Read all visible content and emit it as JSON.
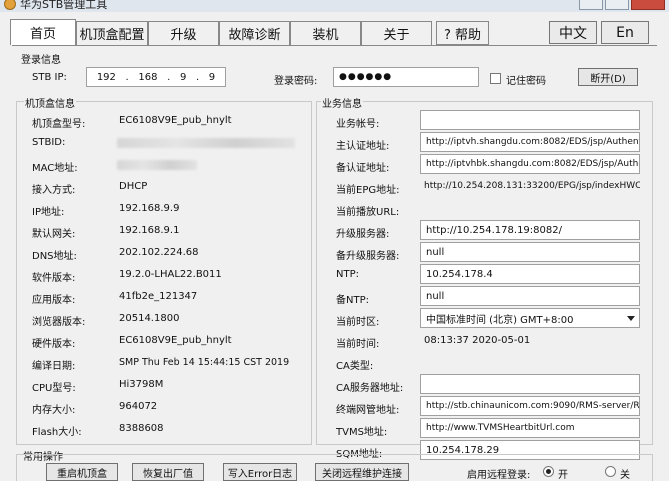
{
  "window": {
    "title": "华为STB管理工具"
  },
  "tabs": [
    {
      "label": "首页"
    },
    {
      "label": "机顶盒配置"
    },
    {
      "label": "升级"
    },
    {
      "label": "故障诊断"
    },
    {
      "label": "装机"
    },
    {
      "label": "关于"
    },
    {
      "label": "? 帮助"
    }
  ],
  "lang": {
    "cn": "中文",
    "en": "En"
  },
  "login": {
    "section": "登录信息",
    "stb_ip_label": "STB IP:",
    "ip": [
      "192",
      "168",
      "9",
      "9"
    ],
    "password_label": "登录密码:",
    "password": "●●●●●●",
    "remember": "记住密码",
    "disconnect": "断开(D)"
  },
  "box_info": {
    "section": "机顶盒信息",
    "rows": [
      {
        "label": "机顶盒型号:",
        "value": "EC6108V9E_pub_hnylt"
      },
      {
        "label": "STBID:",
        "value": ""
      },
      {
        "label": "MAC地址:",
        "value": ""
      },
      {
        "label": "接入方式:",
        "value": "DHCP"
      },
      {
        "label": "IP地址:",
        "value": "192.168.9.9"
      },
      {
        "label": "默认网关:",
        "value": "192.168.9.1"
      },
      {
        "label": "DNS地址:",
        "value": "202.102.224.68"
      },
      {
        "label": "软件版本:",
        "value": "19.2.0-LHAL22.B011"
      },
      {
        "label": "应用版本:",
        "value": "41fb2e_121347"
      },
      {
        "label": "浏览器版本:",
        "value": "20514.1800"
      },
      {
        "label": "硬件版本:",
        "value": "EC6108V9E_pub_hnylt"
      },
      {
        "label": "编译日期:",
        "value": "SMP Thu Feb 14 15:44:15 CST 2019"
      },
      {
        "label": "CPU型号:",
        "value": "Hi3798M"
      },
      {
        "label": "内存大小:",
        "value": "964072"
      },
      {
        "label": "Flash大小:",
        "value": "8388608"
      }
    ]
  },
  "service": {
    "section": "业务信息",
    "rows": [
      {
        "label": "业务帐号:",
        "value": "",
        "type": "input"
      },
      {
        "label": "主认证地址:",
        "value": "http://iptvh.shangdu.com:8082/EDS/jsp/Authenticat",
        "type": "input"
      },
      {
        "label": "备认证地址:",
        "value": "http://iptvhbk.shangdu.com:8082/EDS/jsp/Authentic",
        "type": "input"
      },
      {
        "label": "当前EPG地址:",
        "value": "http://10.254.208.131:33200/EPG/jsp/indexHWCU.j",
        "type": "text"
      },
      {
        "label": "当前播放URL:",
        "value": "",
        "type": "text"
      },
      {
        "label": "升级服务器:",
        "value": "http://10.254.178.19:8082/",
        "type": "input"
      },
      {
        "label": "备升级服务器:",
        "value": "null",
        "type": "input"
      },
      {
        "label": "NTP:",
        "value": "10.254.178.4",
        "type": "input"
      },
      {
        "label": "备NTP:",
        "value": "null",
        "type": "input"
      },
      {
        "label": "当前时区:",
        "value": "中国标准时间 (北京) GMT+8:00",
        "type": "select"
      },
      {
        "label": "当前时间:",
        "value": "08:13:37 2020-05-01",
        "type": "text"
      },
      {
        "label": "CA类型:",
        "value": "",
        "type": "text"
      },
      {
        "label": "CA服务器地址:",
        "value": "",
        "type": "input"
      },
      {
        "label": "终端网管地址:",
        "value": "http://stb.chinaunicom.com:9090/RMS-server/RMS",
        "type": "input"
      },
      {
        "label": "TVMS地址:",
        "value": "http://www.TVMSHeartbitUrl.com",
        "type": "input"
      },
      {
        "label": "SQM地址:",
        "value": "10.254.178.29",
        "type": "input"
      }
    ]
  },
  "common": {
    "section": "常用操作",
    "reboot": "重启机顶盒",
    "factory_reset": "恢复出厂值",
    "write_log": "写入Error日志",
    "close_remote": "关闭远程维护连接",
    "remote_login_label": "启用远程登录:",
    "on": "开",
    "off": "关"
  }
}
